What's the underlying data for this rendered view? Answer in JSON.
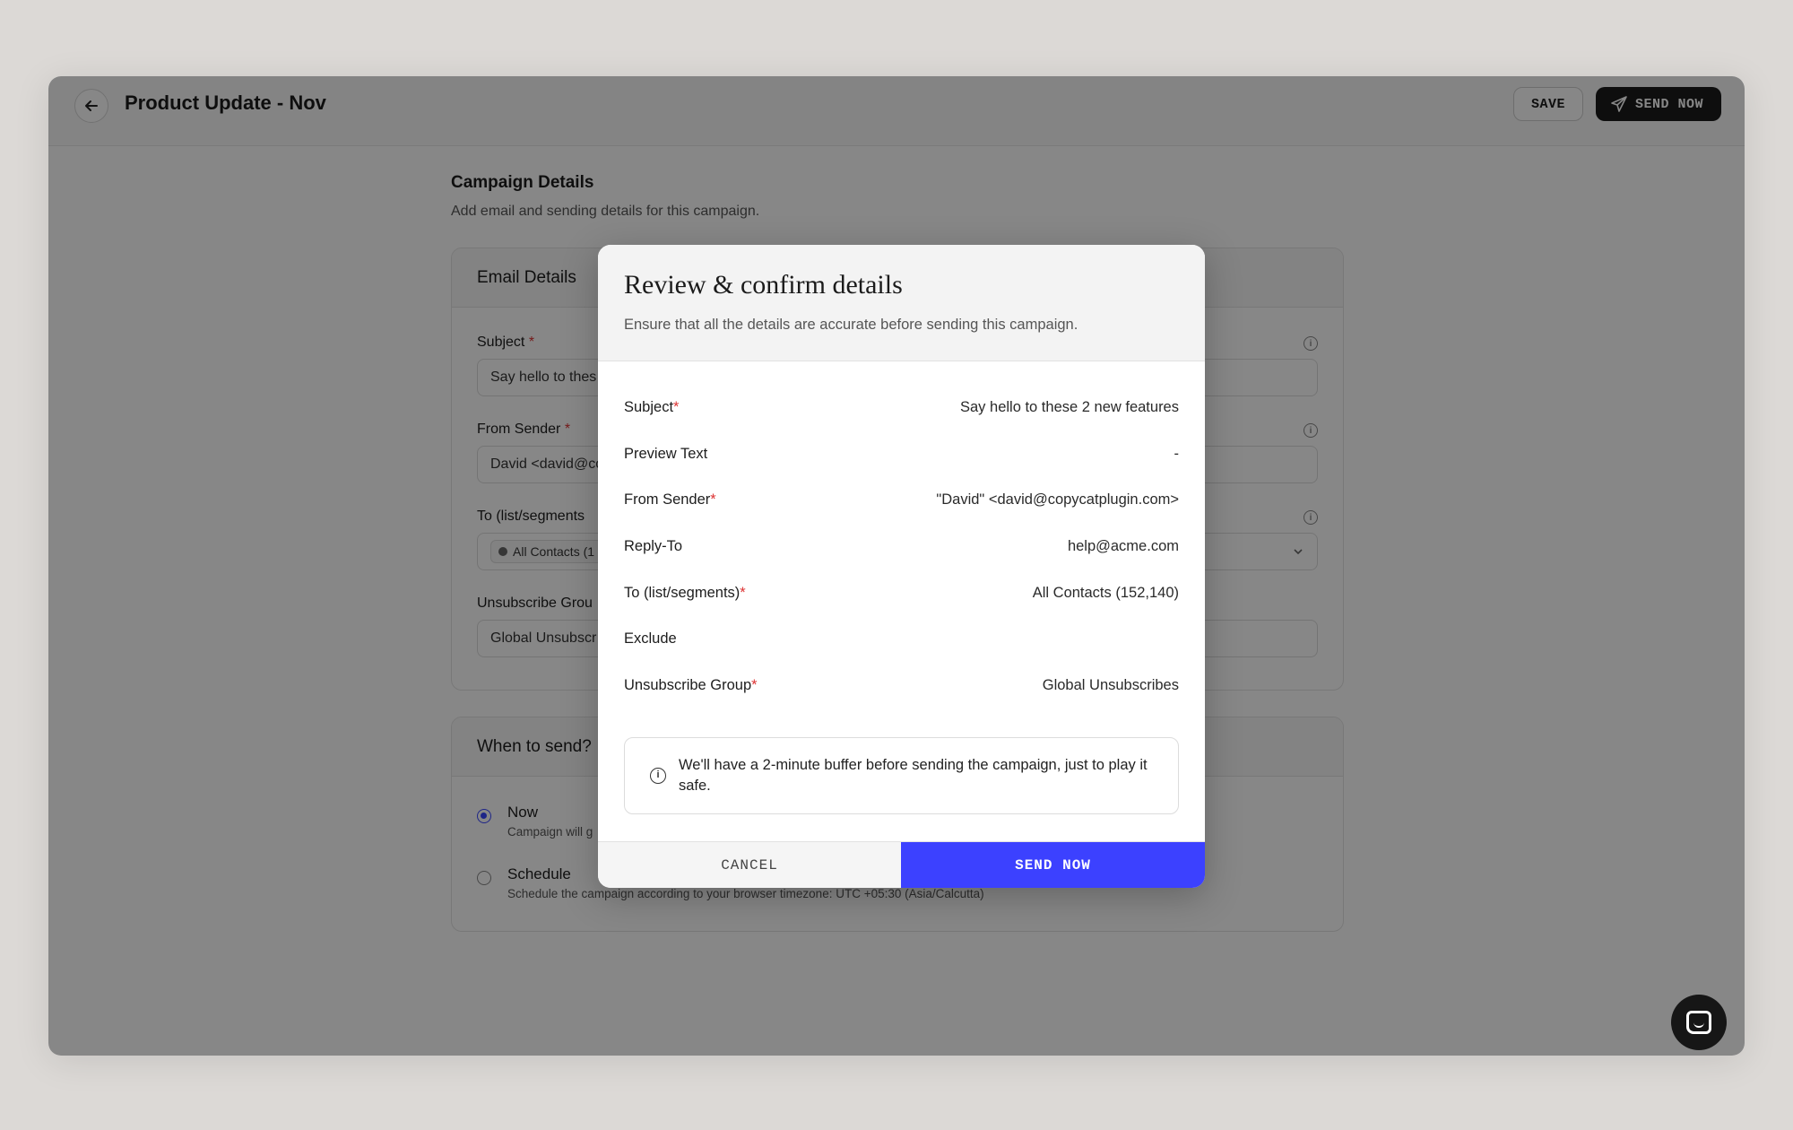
{
  "header": {
    "title": "Product Update - Nov",
    "save_label": "SAVE",
    "send_label": "SEND NOW"
  },
  "page": {
    "section_title": "Campaign Details",
    "section_sub": "Add email and sending details for this campaign.",
    "email_card": {
      "title": "Email Details",
      "subject_label": "Subject",
      "subject_value": "Say hello to thes",
      "sender_label": "From Sender",
      "sender_value": "David <david@co",
      "to_label": "To (list/segments",
      "to_chip": "All Contacts (1",
      "unsub_label": "Unsubscribe Grou",
      "unsub_value": "Global Unsubscr"
    },
    "when_card": {
      "title": "When to send?",
      "now_label": "Now",
      "now_desc": "Campaign will g",
      "schedule_label": "Schedule",
      "schedule_desc": "Schedule the campaign according to your browser timezone:",
      "schedule_tz": "UTC +05:30 (Asia/Calcutta)"
    }
  },
  "modal": {
    "title": "Review & confirm details",
    "subtitle": "Ensure that all the details are accurate before sending this campaign.",
    "rows": [
      {
        "label": "Subject",
        "required": true,
        "value": "Say hello to these 2 new features"
      },
      {
        "label": "Preview Text",
        "required": false,
        "value": "-"
      },
      {
        "label": "From Sender",
        "required": true,
        "value": "\"David\" <david@copycatplugin.com>"
      },
      {
        "label": "Reply-To",
        "required": false,
        "value": "help@acme.com"
      },
      {
        "label": "To (list/segments)",
        "required": true,
        "value": "All Contacts (152,140)"
      },
      {
        "label": "Exclude",
        "required": false,
        "value": ""
      },
      {
        "label": "Unsubscribe Group",
        "required": true,
        "value": "Global Unsubscribes"
      }
    ],
    "notice": "We'll have a 2-minute buffer before sending the campaign, just to play it safe.",
    "cancel_label": "CANCEL",
    "send_label": "SEND NOW"
  },
  "colors": {
    "accent": "#3c41ff",
    "required": "#dd3333"
  },
  "icons": {
    "back": "arrow-left-icon",
    "send": "paper-plane-icon",
    "info": "info-circle-icon",
    "dropdown": "chevron-down-icon",
    "chat": "chat-icon"
  }
}
